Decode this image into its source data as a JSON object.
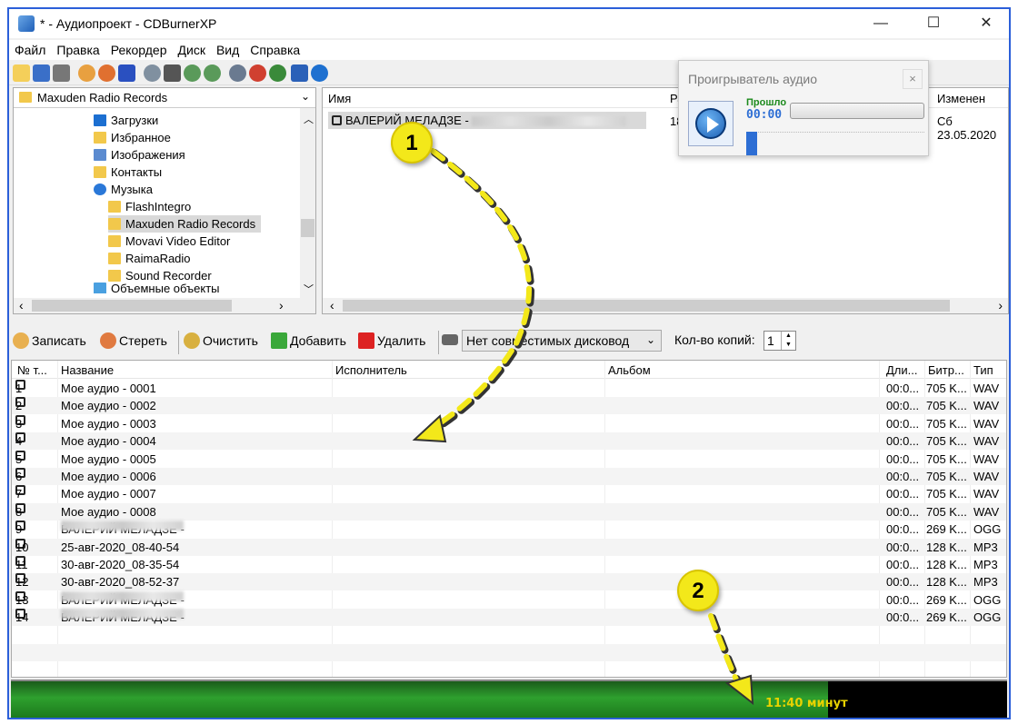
{
  "window": {
    "title": "* - Аудиопроект - CDBurnerXP",
    "minimize_glyph": "—",
    "maximize_glyph": "☐",
    "close_glyph": "✕"
  },
  "menu": [
    "Файл",
    "Правка",
    "Рекордер",
    "Диск",
    "Вид",
    "Справка"
  ],
  "tree": {
    "selected": "Maxuden Radio Records",
    "items": [
      "Загрузки",
      "Избранное",
      "Изображения",
      "Контакты",
      "Музыка",
      "FlashIntegro",
      "Maxuden Radio Records",
      "Movavi Video Editor",
      "RaimaRadio",
      "Sound Recorder",
      "Объемные объекты"
    ]
  },
  "files": {
    "headers": {
      "name": "Имя",
      "size": "Ра",
      "modified": "Изменен"
    },
    "row": {
      "name": "ВАЛЕРИЙ МЕЛАДЗЕ -",
      "size": "18,",
      "modified": "Сб 23.05.2020"
    }
  },
  "player": {
    "title": "Проигрыватель аудио",
    "elapsed_label": "Прошло",
    "elapsed_time": "00:00",
    "close_glyph": "×"
  },
  "actions": {
    "burn": "Записать",
    "erase": "Стереть",
    "clear": "Очистить",
    "add": "Добавить",
    "remove": "Удалить",
    "drive": "Нет совместимых дисковод",
    "copies_label": "Кол-во копий:",
    "copies_value": "1"
  },
  "tracks": {
    "headers": {
      "num": "№ т...",
      "title": "Название",
      "artist": "Исполнитель",
      "album": "Альбом",
      "length": "Дли...",
      "bitrate": "Битр...",
      "type": "Тип"
    },
    "rows": [
      {
        "num": "1",
        "title": "Мое аудио - 0001",
        "length": "00:0...",
        "bitrate": "705 K...",
        "type": "WAV"
      },
      {
        "num": "2",
        "title": "Мое аудио - 0002",
        "length": "00:0...",
        "bitrate": "705 K...",
        "type": "WAV"
      },
      {
        "num": "3",
        "title": "Мое аудио - 0003",
        "length": "00:0...",
        "bitrate": "705 K...",
        "type": "WAV"
      },
      {
        "num": "4",
        "title": "Мое аудио - 0004",
        "length": "00:0...",
        "bitrate": "705 K...",
        "type": "WAV"
      },
      {
        "num": "5",
        "title": "Мое аудио - 0005",
        "length": "00:0...",
        "bitrate": "705 K...",
        "type": "WAV"
      },
      {
        "num": "6",
        "title": "Мое аудио - 0006",
        "length": "00:0...",
        "bitrate": "705 K...",
        "type": "WAV"
      },
      {
        "num": "7",
        "title": "Мое аудио - 0007",
        "length": "00:0...",
        "bitrate": "705 K...",
        "type": "WAV"
      },
      {
        "num": "8",
        "title": "Мое аудио - 0008",
        "length": "00:0...",
        "bitrate": "705 K...",
        "type": "WAV"
      },
      {
        "num": "9",
        "title": "ВАЛЕРИЙ МЕЛАДЗЕ -",
        "length": "00:0...",
        "bitrate": "269 K...",
        "type": "OGG"
      },
      {
        "num": "10",
        "title": "25-авг-2020_08-40-54",
        "length": "00:0...",
        "bitrate": "128 K...",
        "type": "MP3"
      },
      {
        "num": "11",
        "title": "30-авг-2020_08-35-54",
        "length": "00:0...",
        "bitrate": "128 K...",
        "type": "MP3"
      },
      {
        "num": "12",
        "title": "30-авг-2020_08-52-37",
        "length": "00:0...",
        "bitrate": "128 K...",
        "type": "MP3"
      },
      {
        "num": "13",
        "title": "ВАЛЕРИЙ МЕЛАДЗЕ -",
        "length": "00:0...",
        "bitrate": "269 K...",
        "type": "OGG"
      },
      {
        "num": "14",
        "title": "ВАЛЕРИЙ МЕЛАДЗЕ -",
        "length": "00:0...",
        "bitrate": "269 K...",
        "type": "OGG"
      }
    ]
  },
  "status": {
    "total_time": "11:40 минут",
    "disc_used_fraction": 0.82
  },
  "annotations": {
    "badge1": "1",
    "badge2": "2"
  },
  "colors": {
    "window_border": "#2b5fd9",
    "badge": "#f3e81a",
    "status_text": "#e8d200",
    "elapsed_label": "#1c8a1c"
  }
}
